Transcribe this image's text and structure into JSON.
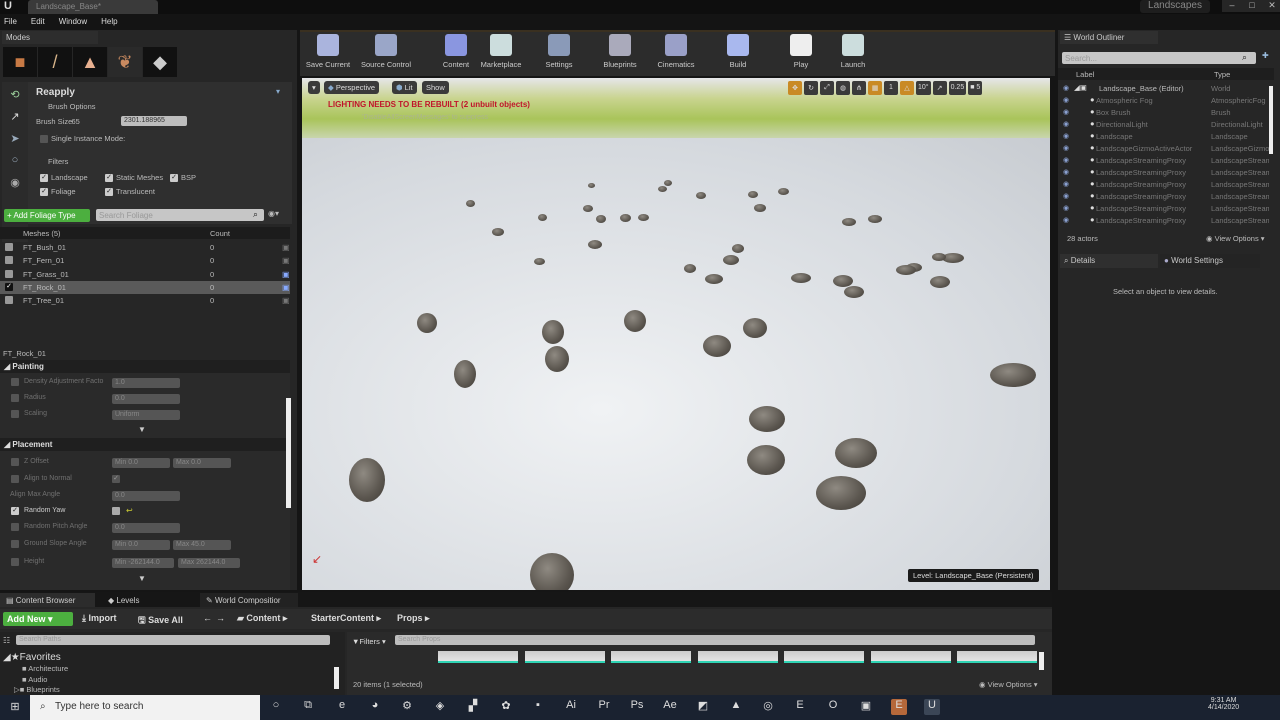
{
  "window": {
    "document_tab": "Landscape_Base*",
    "project": "Landscapes",
    "logo": "U"
  },
  "menu": [
    "File",
    "Edit",
    "Window",
    "Help"
  ],
  "modes": {
    "tab": "Modes",
    "reapply": "Reapply",
    "brush_options": "Brush Options",
    "brush_size_label": "Brush Size",
    "brush_size": "2301.188965",
    "single_instance": "Single Instance Mode:",
    "filters_label": "Filters",
    "filters": [
      {
        "label": "Landscape",
        "checked": true
      },
      {
        "label": "Static Meshes",
        "checked": true
      },
      {
        "label": "BSP",
        "checked": true
      },
      {
        "label": "Foliage",
        "checked": true
      },
      {
        "label": "Translucent",
        "checked": true
      }
    ],
    "add_foliage": "+ Add Foliage Type",
    "search_placeholder": "Search Foliage",
    "meshes_header": "Meshes (5)",
    "count_header": "Count",
    "meshes": [
      {
        "name": "FT_Bush_01",
        "count": "0",
        "checked": false
      },
      {
        "name": "FT_Fern_01",
        "count": "0",
        "checked": false
      },
      {
        "name": "FT_Grass_01",
        "count": "0",
        "checked": false
      },
      {
        "name": "FT_Rock_01",
        "count": "0",
        "checked": true
      },
      {
        "name": "FT_Tree_01",
        "count": "0",
        "checked": false
      }
    ],
    "selected_mesh": "FT_Rock_01",
    "painting": {
      "title": "Painting",
      "rows": [
        {
          "label": "Density Adjustment Facto",
          "value": "1.0"
        },
        {
          "label": "Radius",
          "value": "0.0"
        },
        {
          "label": "Scaling",
          "value": "Uniform"
        }
      ]
    },
    "placement": {
      "title": "Placement",
      "rows": [
        {
          "label": "Z Offset",
          "min": "Min  0.0",
          "max": "Max  0.0"
        },
        {
          "label": "Align to Normal"
        },
        {
          "label": "Align Max Angle",
          "value": "0.0"
        },
        {
          "label": "Random Yaw",
          "checked": true
        },
        {
          "label": "Random Pitch Angle",
          "value": "0.0"
        },
        {
          "label": "Ground Slope Angle",
          "min": "Min  0.0",
          "max": "Max  45.0"
        },
        {
          "label": "Height",
          "min": "Min  -262144.0",
          "max": "Max  262144.0"
        }
      ]
    }
  },
  "toolbar": [
    "Save Current",
    "Source Control",
    "Content",
    "Marketplace",
    "Settings",
    "Blueprints",
    "Cinematics",
    "Build",
    "Play",
    "Launch"
  ],
  "viewport": {
    "perspective": "Perspective",
    "lit": "Lit",
    "show": "Show",
    "warning": "LIGHTING NEEDS TO BE REBUILT (2 unbuilt objects)",
    "warning_sub": "'DisableAllScreenMessages' to suppress",
    "snap_angle": "10°",
    "scale_snap": "0.25",
    "cam_speed": "5",
    "grid": "1",
    "level": "Level:  Landscape_Base (Persistent)"
  },
  "outliner": {
    "tab": "World Outliner",
    "search_placeholder": "Search...",
    "label_header": "Label",
    "type_header": "Type",
    "rows": [
      {
        "label": "Landscape_Base (Editor)",
        "type": "World"
      },
      {
        "label": "Atmospheric Fog",
        "type": "AtmosphericFog"
      },
      {
        "label": "Box Brush",
        "type": "Brush"
      },
      {
        "label": "DirectionalLight",
        "type": "DirectionalLight"
      },
      {
        "label": "Landscape",
        "type": "Landscape"
      },
      {
        "label": "LandscapeGizmoActiveActor",
        "type": "LandscapeGizmo"
      },
      {
        "label": "LandscapeStreamingProxy",
        "type": "LandscapeStreamingProxy"
      },
      {
        "label": "LandscapeStreamingProxy",
        "type": "LandscapeStreamingProxy"
      },
      {
        "label": "LandscapeStreamingProxy",
        "type": "LandscapeStreamingProxy"
      },
      {
        "label": "LandscapeStreamingProxy",
        "type": "LandscapeStreamingProxy"
      },
      {
        "label": "LandscapeStreamingProxy",
        "type": "LandscapeStreamingProxy"
      },
      {
        "label": "LandscapeStreamingProxy",
        "type": "LandscapeStreamingProxy"
      }
    ],
    "actor_count": "28 actors",
    "view_options": "View Options ▾"
  },
  "details": {
    "tab": "Details",
    "world_settings_tab": "World Settings",
    "empty": "Select an object to view details."
  },
  "content_browser": {
    "tabs": [
      "Content Browser",
      "Levels",
      "World Compositior"
    ],
    "add_new": "Add New ▾",
    "import": "Import",
    "save_all": "Save All",
    "breadcrumb": [
      "Content",
      "StarterContent",
      "Props"
    ],
    "search_paths": "Search Paths",
    "filters": "Filters ▾",
    "search_props": "Search Props",
    "tree": [
      "Favorites",
      "Architecture",
      "Audio",
      "Blueprints"
    ],
    "status": "20 items (1 selected)",
    "view_options": "View Options ▾"
  },
  "taskbar": {
    "search": "Type here to search",
    "time": "9:31 AM",
    "date": "4/14/2020"
  }
}
